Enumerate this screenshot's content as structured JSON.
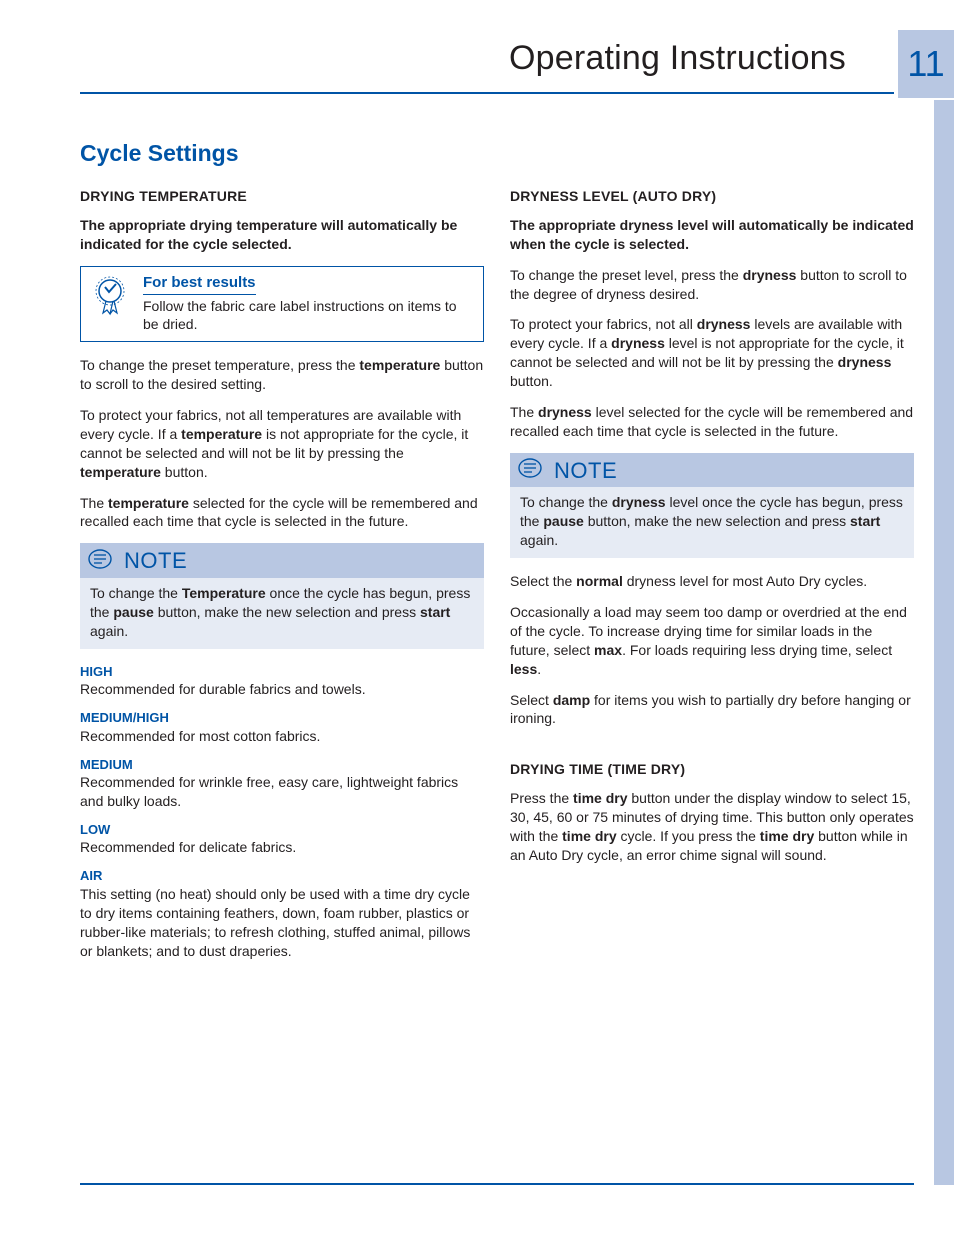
{
  "page": {
    "title": "Operating Instructions",
    "number": "11"
  },
  "section_title": "Cycle Settings",
  "left": {
    "heading": "DRYING TEMPERATURE",
    "intro": "The appropriate drying temperature will automatically be indicated for the cycle selected.",
    "tip_title": "For best results",
    "tip_text": "Follow the fabric care label instructions on items to be dried.",
    "p1a": "To change the preset temperature, press the ",
    "p1b": "tem­perature",
    "p1c": " button to scroll to the desired setting.",
    "p2a": "To protect your fabrics, not all temperatures are available with every cycle. If a ",
    "p2b": "temperature",
    "p2c": " is not appropriate for the cycle, it cannot be selected and will not be lit by pressing the ",
    "p2d": "temperature",
    "p2e": " button.",
    "p3a": "The ",
    "p3b": "temperature",
    "p3c": " selected for the cycle will be remembered and recalled each time that cycle is selected in the future.",
    "note_label": "NOTE",
    "note_a": "To change the ",
    "note_b": "Temperature",
    "note_c": " once the cycle has begun, press the ",
    "note_d": "pause",
    "note_e": " button, make the new selection and press ",
    "note_f": "start",
    "note_g": " again.",
    "levels": {
      "high_t": "HIGH",
      "high_d": "Recommended for durable fabrics and towels.",
      "medhigh_t": "MEDIUM/HIGH",
      "medhigh_d": "Recommended for most cotton fabrics.",
      "med_t": "MEDIUM",
      "med_d": "Recommended for wrinkle free, easy care, light­weight fabrics and bulky loads.",
      "low_t": "LOW",
      "low_d": "Recommended for delicate fabrics.",
      "air_t": "AIR",
      "air_d": "This setting (no heat) should only be used with a time dry cycle to dry items containing feathers, down, foam rubber, plastics or rubber-like materials; to refresh clothing, stuffed animal, pillows or blan­kets; and to dust draperies."
    }
  },
  "right": {
    "heading": "DRYNESS LEVEL (AUTO DRY)",
    "intro": "The appropriate dryness level will automatically be indicated when the cycle is selected.",
    "p1a": "To change the preset level, press the ",
    "p1b": "dryness",
    "p1c": " but­ton to scroll to the degree of dryness desired.",
    "p2a": "To protect your fabrics, not all ",
    "p2b": "dryness",
    "p2c": " levels are available with every cycle. If a ",
    "p2d": "dryness",
    "p2e": " level is not appropriate for the cycle, it cannot be selected and will not be lit by pressing the ",
    "p2f": "dryness",
    "p2g": " button.",
    "p3a": "The ",
    "p3b": "dryness",
    "p3c": " level selected for the cycle will be remembered and recalled each time that cycle is selected in the future.",
    "note_label": "NOTE",
    "note_a": "To change the ",
    "note_b": "dryness",
    "note_c": " level once the cycle has begun, press the ",
    "note_d": "pause",
    "note_e": " button, make the new selection and press ",
    "note_f": "start",
    "note_g": " again.",
    "p4a": "Select the ",
    "p4b": "normal",
    "p4c": " dryness level for most Auto Dry cycles.",
    "p5a": "Occasionally a load may seem too damp or over­dried at the end of the cycle. To increase drying time for similar loads in the future, select ",
    "p5b": "max",
    "p5c": ". For loads requiring less drying time, select ",
    "p5d": "less",
    "p5e": ".",
    "p6a": "Select ",
    "p6b": "damp",
    "p6c": " for items you wish to partially dry be­fore hanging or ironing.",
    "heading2": "DRYING TIME (TIME DRY)",
    "t1a": "Press the ",
    "t1b": "time dry",
    "t1c": " button under the display window to select 15, 30, 45, 60 or 75 minutes of drying time. This button only operates with the ",
    "t1d": "time dry",
    "t1e": " cycle. If you press the ",
    "t1f": "time dry",
    "t1g": " button while in an Auto Dry cycle, an error chime signal will sound."
  }
}
